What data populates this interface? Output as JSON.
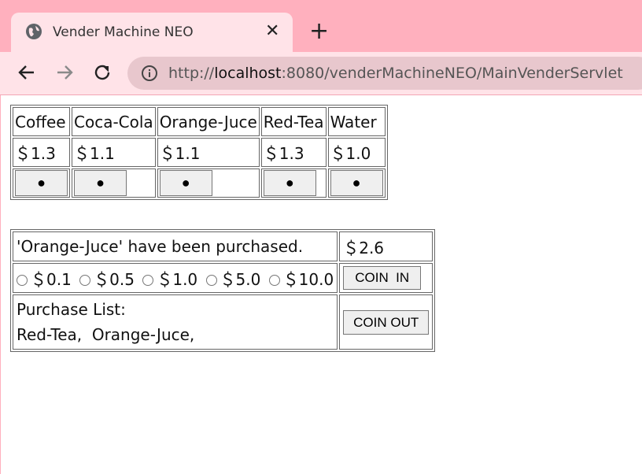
{
  "browser": {
    "tab_title": "Vender Machine NEO",
    "tab_close": "✕",
    "new_tab": "+",
    "url_scheme": "http://",
    "url_host": "localhost",
    "url_rest": ":8080/venderMachineNEO/MainVenderServlet"
  },
  "products": {
    "names": [
      "Coffee",
      "Coca-Cola",
      "Orange-Juce",
      "Red-Tea",
      "Water"
    ],
    "prices": [
      "＄1.3",
      "＄1.1",
      "＄1.1",
      "＄1.3",
      "＄1.0"
    ],
    "buy_button_label": "●"
  },
  "status": {
    "message": "'Orange-Juce' have been purchased.",
    "balance": "＄2.6"
  },
  "coins": {
    "options": [
      "＄0.1",
      "＄0.5",
      "＄1.0",
      "＄5.0",
      "＄10.0"
    ],
    "coin_in_label": "COIN  IN",
    "coin_out_label": "COIN OUT"
  },
  "purchase_list": {
    "heading": "Purchase List:",
    "items": "Red-Tea,  Orange-Juce,"
  }
}
